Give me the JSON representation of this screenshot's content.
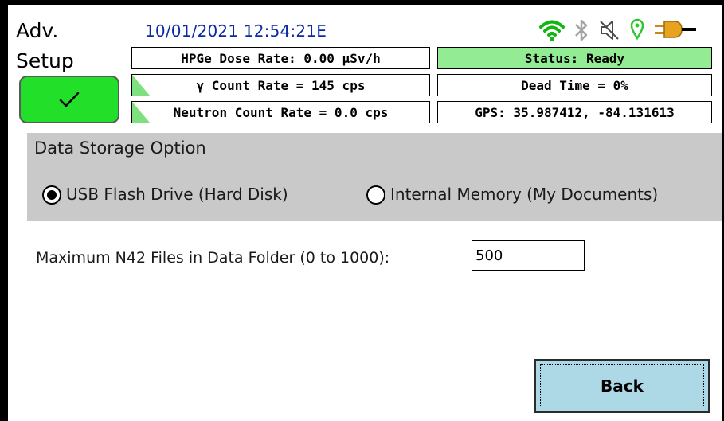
{
  "header": {
    "title_line1": "Adv.",
    "title_line2": "Setup",
    "datetime": "10/01/2021 12:54:21E",
    "status_icons": [
      "wifi-icon",
      "bluetooth-icon",
      "speaker-muted-icon",
      "gps-pin-icon",
      "power-plug-icon"
    ]
  },
  "readouts": {
    "dose_rate": "HPGe Dose Rate: 0.00  µSv/h",
    "status": "Status: Ready",
    "gamma_rate": "γ Count Rate = 145 cps",
    "dead_time": "Dead Time = 0%",
    "neutron_rate": "Neutron Count Rate = 0.0 cps",
    "gps": "GPS: 35.987412, -84.131613"
  },
  "storage": {
    "title": "Data Storage Option",
    "options": [
      {
        "label": "USB Flash Drive (Hard Disk)",
        "selected": true
      },
      {
        "label": "Internal Memory (My Documents)",
        "selected": false
      }
    ]
  },
  "max_files": {
    "label": "Maximum N42 Files in Data Folder (0 to 1000):",
    "value": "500"
  },
  "buttons": {
    "back": "Back"
  },
  "colors": {
    "ok_button": "#22e02a",
    "status_ready": "#93ec93",
    "datetime_text": "#0b2aa3",
    "panel_gray": "#c9c9c9",
    "back_button": "#add8e6"
  }
}
